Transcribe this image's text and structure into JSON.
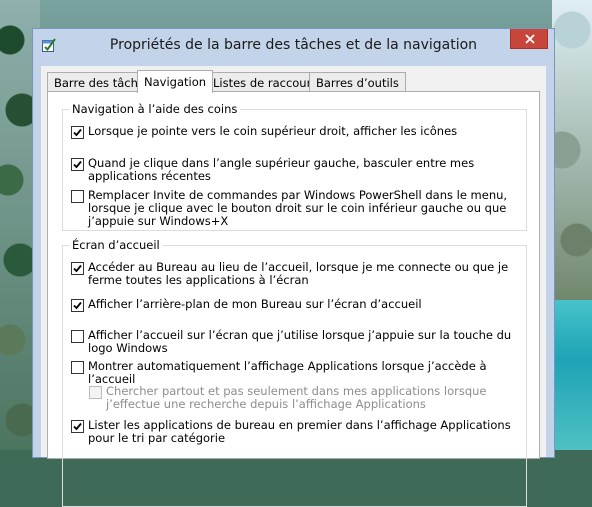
{
  "window": {
    "title": "Propriétés de la barre des tâches et de la navigation",
    "app_icon": "checkbox-app-icon",
    "close_icon": "close-icon",
    "close_color": "#c7463b"
  },
  "tabs": [
    {
      "label": "Barre des tâches",
      "active": false
    },
    {
      "label": "Navigation",
      "active": true
    },
    {
      "label": "Listes de raccourcis",
      "active": false
    },
    {
      "label": "Barres d’outils",
      "active": false
    }
  ],
  "groups": {
    "corners": {
      "title": "Navigation à l’aide des coins",
      "options": [
        {
          "label": "Lorsque je pointe vers le coin supérieur droit, afficher les icônes",
          "checked": true,
          "enabled": true
        },
        {
          "label": "Quand je clique dans l’angle supérieur gauche, basculer entre mes applications récentes",
          "checked": true,
          "enabled": true
        },
        {
          "label": "Remplacer Invite de commandes par Windows PowerShell dans le menu, lorsque je clique avec le bouton droit sur le coin inférieur gauche ou que j’appuie sur Windows+X",
          "checked": false,
          "enabled": true
        }
      ]
    },
    "start": {
      "title": "Écran d’accueil",
      "options": [
        {
          "label": "Accéder au Bureau au lieu de l’accueil, lorsque je me connecte ou que je ferme toutes les applications à l’écran",
          "checked": true,
          "enabled": true
        },
        {
          "label": "Afficher l’arrière-plan de mon Bureau sur l’écran d’accueil",
          "checked": true,
          "enabled": true
        },
        {
          "label": "Afficher l’accueil sur l’écran que j’utilise lorsque j’appuie sur la touche du logo Windows",
          "checked": false,
          "enabled": true
        },
        {
          "label": "Montrer automatiquement l’affichage Applications lorsque j’accède à l’accueil",
          "checked": false,
          "enabled": true
        },
        {
          "label": "Chercher partout et pas seulement dans mes applications lorsque j’effectue une recherche depuis l’affichage Applications",
          "checked": false,
          "enabled": false
        },
        {
          "label": "Lister les applications de bureau en premier dans l’affichage Applications pour le tri par catégorie",
          "checked": true,
          "enabled": true
        }
      ]
    }
  }
}
